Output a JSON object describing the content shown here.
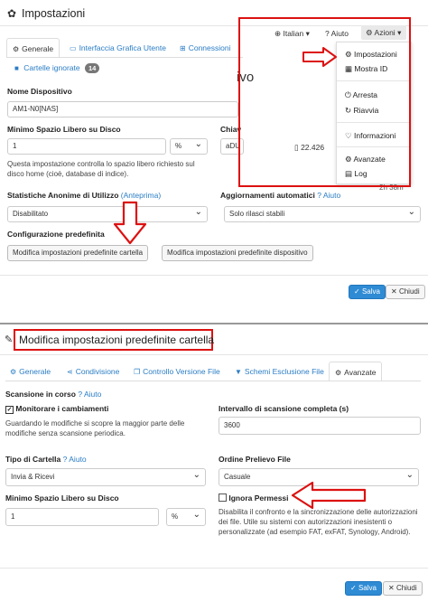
{
  "top": {
    "title": "Impostazioni",
    "language_btn": "Italian",
    "help_btn": "Aiuto",
    "actions_btn": "Azioni",
    "tabs": [
      "Generale",
      "Interfaccia Grafica Utente",
      "Connessioni"
    ],
    "ignored_tab": "Cartelle ignorate",
    "ignored_count": "14",
    "device_name_label": "Nome Dispositivo",
    "device_name_value": "AM1-N0[NAS]",
    "min_free_label": "Minimo Spazio Libero su Disco",
    "min_free_value": "1",
    "min_free_unit": "%",
    "min_free_help": "Questa impostazione controlla lo spazio libero richiesto sul disco home (cioè, database di indice).",
    "api_label_partial": "Chiav",
    "api_value_partial": "aDU",
    "api_count": "22.426",
    "stats_label": "Statistiche Anonime di Utilizzo",
    "stats_preview": "(Anteprima)",
    "stats_value": "Disabilitato",
    "updates_label": "Aggiornamenti automatici",
    "updates_help": "Aiuto",
    "updates_value": "Solo rilasci stabili",
    "defaults_label": "Configurazione predefinita",
    "btn_edit_folder": "Modifica impostazioni predefinite cartella",
    "btn_edit_device": "Modifica impostazioni predefinite dispositivo",
    "background_text": "ivo",
    "background_small": "2h 38m",
    "save": "Salva",
    "close": "Chiudi"
  },
  "menu": {
    "items": [
      "Impostazioni",
      "Mostra ID",
      "Arresta",
      "Riavvia",
      "Informazioni",
      "Avanzate",
      "Log"
    ]
  },
  "bottom": {
    "title": "Modifica impostazioni predefinite cartella",
    "tabs": [
      "Generale",
      "Condivisione",
      "Controllo Versione File",
      "Schemi Esclusione File",
      "Avanzate"
    ],
    "scan_label": "Scansione in corso",
    "scan_help": "Aiuto",
    "watch_label": "Monitorare i cambiamenti",
    "watch_help": "Guardando le modifiche si scopre la maggior parte delle modifiche senza scansione periodica.",
    "interval_label": "Intervallo di scansione completa (s)",
    "interval_value": "3600",
    "type_label": "Tipo di Cartella",
    "type_help": "Aiuto",
    "type_value": "Invia & Ricevi",
    "order_label": "Ordine Prelievo File",
    "order_value": "Casuale",
    "min_free_label": "Minimo Spazio Libero su Disco",
    "min_free_value": "1",
    "min_free_unit": "%",
    "ignore_perms_label": "Ignora Permessi",
    "ignore_perms_help": "Disabilita il confronto e la sincronizzazione delle autorizzazioni dei file. Utile su sistemi con autorizzazioni inesistenti o personalizzate (ad esempio FAT, exFAT, Synology, Android).",
    "save": "Salva",
    "close": "Chiudi"
  },
  "colors": {
    "accent": "#2a7dc5",
    "primary_button": "#2e8bd4",
    "highlight": "#d11111"
  }
}
